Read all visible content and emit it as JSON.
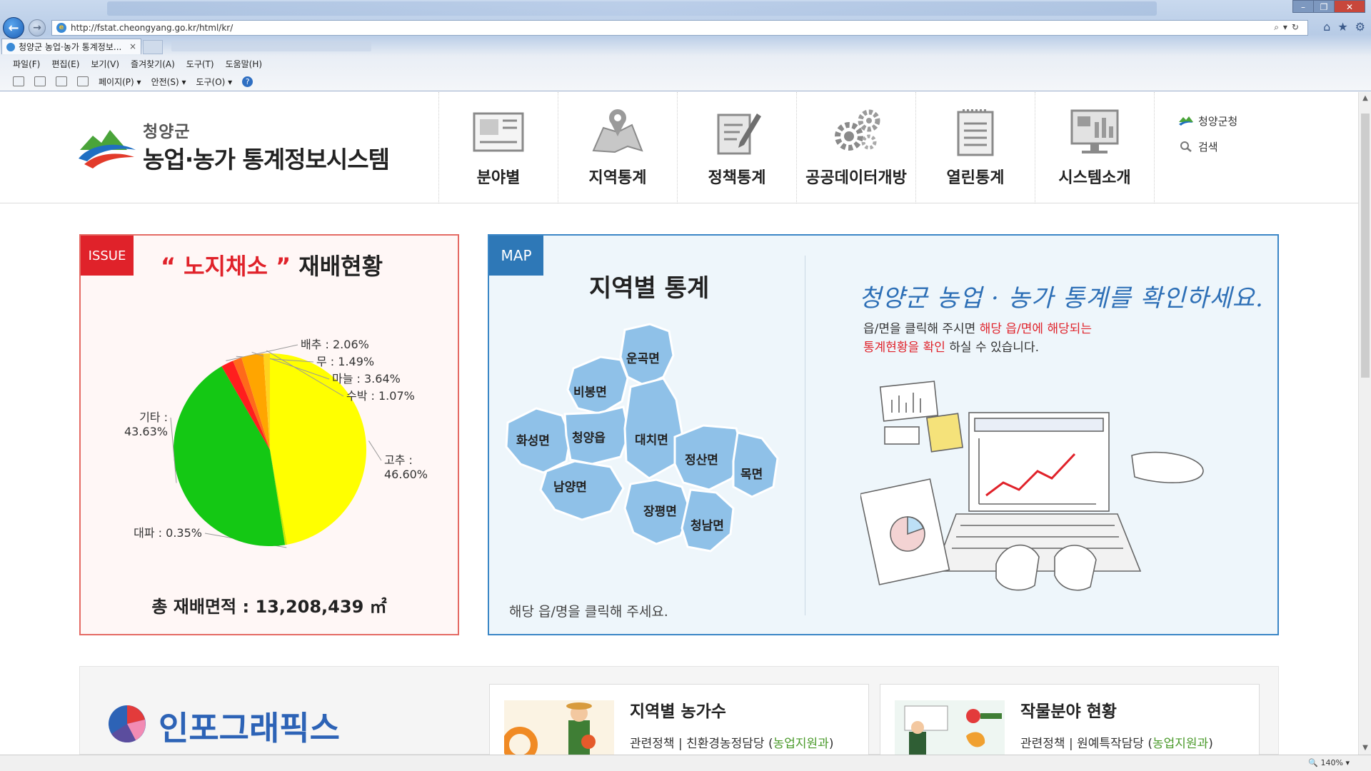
{
  "browser": {
    "url": "http://fstat.cheongyang.go.kr/html/kr/",
    "tab_title": "청양군 농업·농가 통계정보...",
    "tab_close": "×",
    "menu": [
      "파일(F)",
      "편집(E)",
      "보기(V)",
      "즐겨찾기(A)",
      "도구(T)",
      "도움말(H)"
    ],
    "commands": [
      "페이지(P) ▾",
      "안전(S) ▾",
      "도구(O) ▾"
    ],
    "zoom": "140%"
  },
  "header": {
    "logo_small": "청양군",
    "logo_big": "농업·농가 통계정보시스템",
    "nav": [
      {
        "label": "분야별",
        "icon": "newspaper-icon"
      },
      {
        "label": "지역통계",
        "icon": "map-pin-icon"
      },
      {
        "label": "정책통계",
        "icon": "document-pen-icon"
      },
      {
        "label": "공공데이터개방",
        "icon": "gears-icon"
      },
      {
        "label": "열린통계",
        "icon": "checklist-icon"
      },
      {
        "label": "시스템소개",
        "icon": "monitor-icon"
      }
    ],
    "util": {
      "county": "청양군청",
      "search": "검색"
    }
  },
  "issue": {
    "badge": "ISSUE",
    "title_open": "“ ",
    "title_keyword": "노지채소",
    "title_close": " ”",
    "title_rest": " 재배현황",
    "total": "총 재배면적 : 13,208,439 ㎡"
  },
  "chart_data": {
    "type": "pie",
    "slices": [
      {
        "name": "고추",
        "value": 46.6,
        "label": "고추 :",
        "pct": "46.60%",
        "color": "#ffff00"
      },
      {
        "name": "대파",
        "value": 0.35,
        "label": "대파 : 0.35%",
        "color": "#c8e800"
      },
      {
        "name": "기타",
        "value": 43.63,
        "label": "기타 :",
        "pct": "43.63%",
        "color": "#14c814"
      },
      {
        "name": "배추",
        "value": 2.06,
        "label": "배추 : 2.06%",
        "color": "#ff1e1e"
      },
      {
        "name": "무",
        "value": 1.49,
        "label": "무 : 1.49%",
        "color": "#ff6a1a"
      },
      {
        "name": "마늘",
        "value": 3.64,
        "label": "마늘 : 3.64%",
        "color": "#ffa500"
      },
      {
        "name": "수박",
        "value": 1.07,
        "label": "수박 : 1.07%",
        "color": "#ffd21e"
      }
    ]
  },
  "map": {
    "badge": "MAP",
    "title": "지역별 통계",
    "guide": "해당 읍/명을 클릭해 주세요.",
    "slogan": "청양군 농업 · 농가 통계를 확인하세요.",
    "desc_1a": "읍/면을 클릭해 주시면 ",
    "desc_1b": "해당 읍/면에 해당되는",
    "desc_2a": "통계현황을 확인",
    "desc_2b": " 하실 수 있습니다.",
    "regions": [
      "운곡면",
      "비봉면",
      "화성면",
      "청양읍",
      "대치면",
      "남양면",
      "정산면",
      "목면",
      "장평면",
      "청남면"
    ],
    "region_color": "#8fc1e8"
  },
  "infographic": {
    "title": "인포그래픽스",
    "cards": [
      {
        "title": "지역별 농가수",
        "sub_prefix": "관련정책 | 친환경농정담당 (",
        "sub_dept": "농업지원과",
        "sub_suffix": ")"
      },
      {
        "title": "작물분야 현황",
        "sub_prefix": "관련정책 | 원예특작담당 (",
        "sub_dept": "농업지원과",
        "sub_suffix": ")"
      }
    ]
  }
}
